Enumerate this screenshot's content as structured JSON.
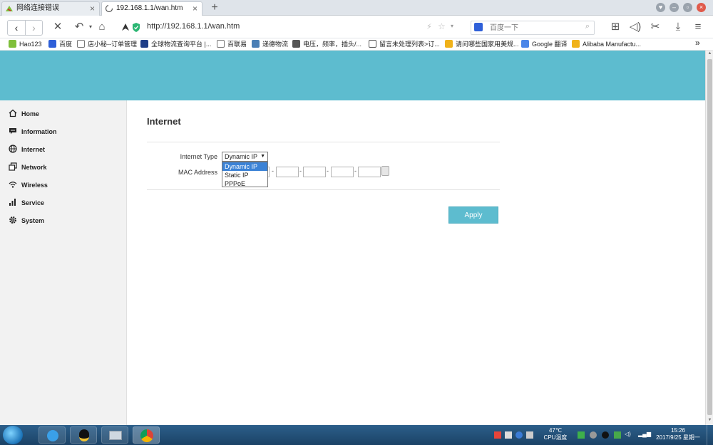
{
  "browser": {
    "tabs": [
      {
        "title": "网络连接错误",
        "close": "×"
      },
      {
        "title": "192.168.1.1/wan.htm",
        "close": "×"
      }
    ],
    "new_tab": "+",
    "url": "http://192.168.1.1/wan.htm",
    "search_placeholder": "百度一下",
    "bookmarks": [
      "Hao123",
      "百度",
      "店小秘--订单管理",
      "全球物流查询平台 |...",
      "百联易",
      "递德物流",
      "电压，频率，插头/...",
      "留言未处理列表>订...",
      "请问哪些国家用美规...",
      "Google 翻译",
      "Alibaba Manufactu..."
    ],
    "bookmarks_more": "»"
  },
  "sidebar": {
    "items": [
      {
        "label": "Home",
        "icon": "home-icon"
      },
      {
        "label": "Information",
        "icon": "chat-icon"
      },
      {
        "label": "Internet",
        "icon": "globe-icon"
      },
      {
        "label": "Network",
        "icon": "network-icon"
      },
      {
        "label": "Wireless",
        "icon": "wifi-icon"
      },
      {
        "label": "Service",
        "icon": "bar-chart-icon"
      },
      {
        "label": "System",
        "icon": "gear-icon"
      }
    ]
  },
  "main": {
    "title": "Internet",
    "internet_type_label": "Internet Type",
    "internet_type_selected": "Dynamic IP",
    "internet_type_options": [
      "Dynamic IP",
      "Static IP",
      "PPPoE"
    ],
    "mac_label": "MAC Address",
    "mac_separator": "-",
    "apply_label": "Apply"
  },
  "taskbar": {
    "temp": "47℃",
    "temp_label": "CPU温度",
    "time": "15:26",
    "date": "2017/9/25 星期一"
  },
  "colors": {
    "accent": "#5dbccf",
    "sidebar_bg": "#f2f2f2",
    "selected_option": "#3b82d6",
    "taskbar": "#1f4b74"
  }
}
